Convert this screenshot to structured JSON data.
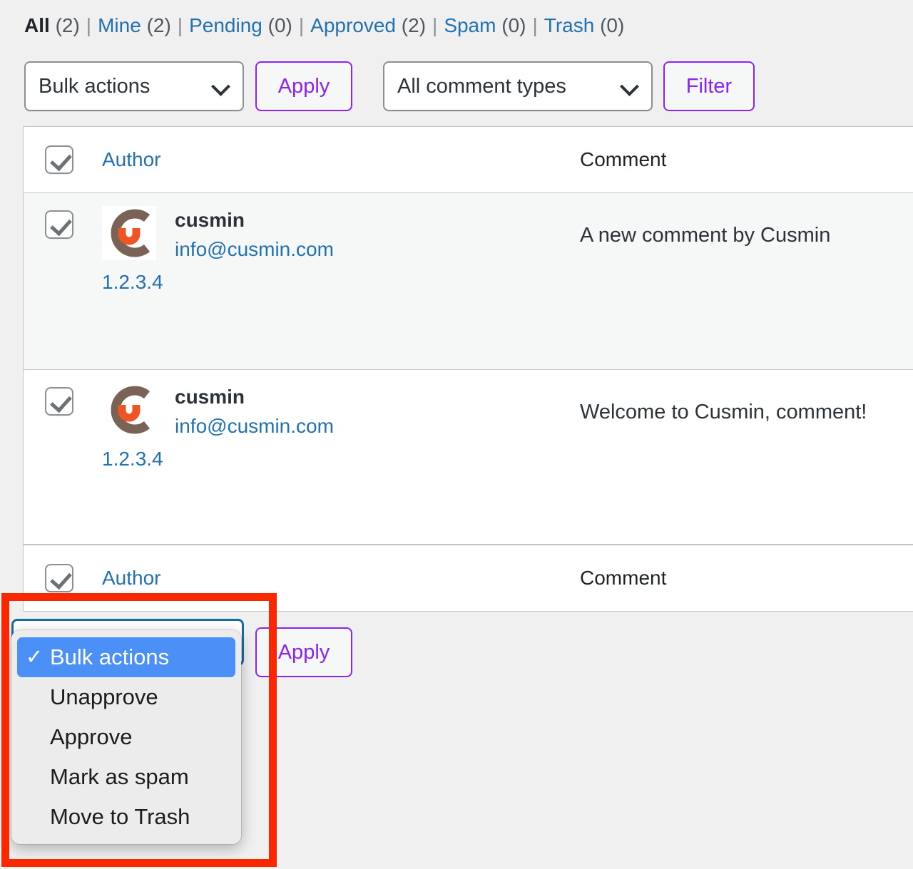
{
  "filters": {
    "items": [
      {
        "label": "All",
        "count": "(2)",
        "current": true
      },
      {
        "label": "Mine",
        "count": "(2)",
        "current": false
      },
      {
        "label": "Pending",
        "count": "(0)",
        "current": false
      },
      {
        "label": "Approved",
        "count": "(2)",
        "current": false
      },
      {
        "label": "Spam",
        "count": "(0)",
        "current": false
      },
      {
        "label": "Trash",
        "count": "(0)",
        "current": false
      }
    ],
    "separator": "|"
  },
  "toolbar_top": {
    "bulk_select_value": "Bulk actions",
    "apply_label": "Apply",
    "type_select_value": "All comment types",
    "filter_label": "Filter"
  },
  "toolbar_bottom": {
    "bulk_select_value": "Bulk actions",
    "apply_label": "Apply"
  },
  "table": {
    "columns": {
      "author": "Author",
      "comment": "Comment"
    },
    "rows": [
      {
        "author_name": "cusmin",
        "author_email": "info@cusmin.com",
        "author_ip": "1.2.3.4",
        "comment": "A new comment by Cusmin"
      },
      {
        "author_name": "cusmin",
        "author_email": "info@cusmin.com",
        "author_ip": "1.2.3.4",
        "comment": "Welcome to Cusmin, comment!"
      }
    ]
  },
  "bulk_dropdown": {
    "options": [
      {
        "label": "Bulk actions",
        "selected": true
      },
      {
        "label": "Unapprove",
        "selected": false
      },
      {
        "label": "Approve",
        "selected": false
      },
      {
        "label": "Mark as spam",
        "selected": false
      },
      {
        "label": "Move to Trash",
        "selected": false
      }
    ],
    "check_glyph": "✓"
  },
  "colors": {
    "link_blue": "#2271b1",
    "accent_purple": "#8c23f5",
    "highlight_red": "#fa2800",
    "selected_blue": "#4a90f7",
    "logo_brown": "#7a6257",
    "logo_orange": "#ee5524"
  }
}
